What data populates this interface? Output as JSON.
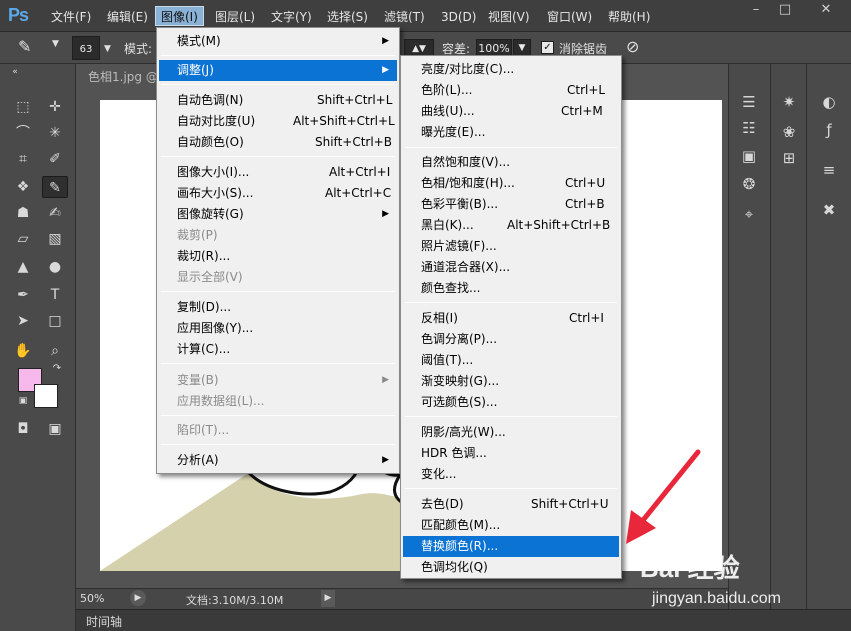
{
  "app": {
    "logo": "Ps"
  },
  "menubar": {
    "items": [
      "文件(F)",
      "编辑(E)",
      "图像(I)",
      "图层(L)",
      "文字(Y)",
      "选择(S)",
      "滤镜(T)",
      "3D(D)",
      "视图(V)",
      "窗口(W)",
      "帮助(H)"
    ],
    "active": "图像(I)"
  },
  "options": {
    "brush_size": "63",
    "mode_label": "模式:",
    "tolerance_label": "容差:",
    "tolerance_value": "100%",
    "antialias_label": "消除锯齿"
  },
  "document": {
    "tab_title": "色相1.jpg @",
    "zoom": "50%",
    "doc_size": "文档:3.10M/3.10M"
  },
  "timeline": {
    "label": "时间轴"
  },
  "image_menu": {
    "items": [
      {
        "label": "模式(M)",
        "shortcut": "",
        "submenu": true,
        "disabled": false
      },
      {
        "sep": true
      },
      {
        "label": "调整(J)",
        "shortcut": "",
        "submenu": true,
        "disabled": false,
        "highlighted": true
      },
      {
        "sep": true
      },
      {
        "label": "自动色调(N)",
        "shortcut": "Shift+Ctrl+L",
        "disabled": false
      },
      {
        "label": "自动对比度(U)",
        "shortcut": "Alt+Shift+Ctrl+L",
        "disabled": false
      },
      {
        "label": "自动颜色(O)",
        "shortcut": "Shift+Ctrl+B",
        "disabled": false
      },
      {
        "sep": true
      },
      {
        "label": "图像大小(I)...",
        "shortcut": "Alt+Ctrl+I",
        "disabled": false
      },
      {
        "label": "画布大小(S)...",
        "shortcut": "Alt+Ctrl+C",
        "disabled": false
      },
      {
        "label": "图像旋转(G)",
        "shortcut": "",
        "submenu": true,
        "disabled": false
      },
      {
        "label": "裁剪(P)",
        "shortcut": "",
        "disabled": true
      },
      {
        "label": "裁切(R)...",
        "shortcut": "",
        "disabled": false
      },
      {
        "label": "显示全部(V)",
        "shortcut": "",
        "disabled": true
      },
      {
        "sep": true
      },
      {
        "label": "复制(D)...",
        "shortcut": "",
        "disabled": false
      },
      {
        "label": "应用图像(Y)...",
        "shortcut": "",
        "disabled": false
      },
      {
        "label": "计算(C)...",
        "shortcut": "",
        "disabled": false
      },
      {
        "sep": true
      },
      {
        "label": "变量(B)",
        "shortcut": "",
        "submenu": true,
        "disabled": true
      },
      {
        "label": "应用数据组(L)...",
        "shortcut": "",
        "disabled": true
      },
      {
        "sep": true
      },
      {
        "label": "陷印(T)...",
        "shortcut": "",
        "disabled": true
      },
      {
        "sep": true
      },
      {
        "label": "分析(A)",
        "shortcut": "",
        "submenu": true,
        "disabled": false
      }
    ]
  },
  "adjust_menu": {
    "items": [
      {
        "label": "亮度/对比度(C)...",
        "shortcut": ""
      },
      {
        "label": "色阶(L)...",
        "shortcut": "Ctrl+L"
      },
      {
        "label": "曲线(U)...",
        "shortcut": "Ctrl+M"
      },
      {
        "label": "曝光度(E)...",
        "shortcut": ""
      },
      {
        "sep": true
      },
      {
        "label": "自然饱和度(V)...",
        "shortcut": ""
      },
      {
        "label": "色相/饱和度(H)...",
        "shortcut": "Ctrl+U"
      },
      {
        "label": "色彩平衡(B)...",
        "shortcut": "Ctrl+B"
      },
      {
        "label": "黑白(K)...",
        "shortcut": "Alt+Shift+Ctrl+B"
      },
      {
        "label": "照片滤镜(F)...",
        "shortcut": ""
      },
      {
        "label": "通道混合器(X)...",
        "shortcut": ""
      },
      {
        "label": "颜色查找...",
        "shortcut": ""
      },
      {
        "sep": true
      },
      {
        "label": "反相(I)",
        "shortcut": "Ctrl+I"
      },
      {
        "label": "色调分离(P)...",
        "shortcut": ""
      },
      {
        "label": "阈值(T)...",
        "shortcut": ""
      },
      {
        "label": "渐变映射(G)...",
        "shortcut": ""
      },
      {
        "label": "可选颜色(S)...",
        "shortcut": ""
      },
      {
        "sep": true
      },
      {
        "label": "阴影/高光(W)...",
        "shortcut": ""
      },
      {
        "label": "HDR 色调...",
        "shortcut": ""
      },
      {
        "label": "变化...",
        "shortcut": ""
      },
      {
        "sep": true
      },
      {
        "label": "去色(D)",
        "shortcut": "Shift+Ctrl+U"
      },
      {
        "label": "匹配颜色(M)...",
        "shortcut": ""
      },
      {
        "label": "替换颜色(R)...",
        "shortcut": "",
        "highlighted": true
      },
      {
        "label": "色调均化(Q)",
        "shortcut": ""
      }
    ]
  },
  "watermark": {
    "brand": "Bai 经验",
    "url": "jingyan.baidu.com"
  },
  "colors": {
    "highlight": "#0b73d4",
    "foreground_swatch": "#f7b8ec",
    "arrow": "#e8283a"
  }
}
